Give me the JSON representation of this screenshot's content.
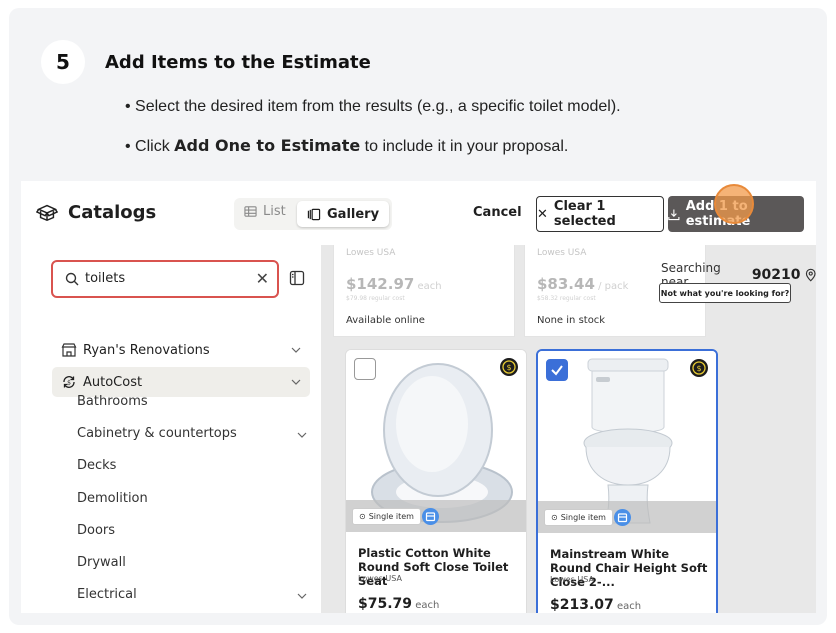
{
  "step": {
    "number": "5",
    "title": "Add Items to the Estimate",
    "bullets": [
      {
        "prefix": "• Select the desired item from the results (e.g., a specific toilet model).",
        "bold": "",
        "suffix": ""
      },
      {
        "prefix": "• Click ",
        "bold": "Add One to Estimate",
        "suffix": " to include it in your proposal."
      }
    ]
  },
  "app": {
    "title": "Catalogs",
    "view_list": "List",
    "view_gallery": "Gallery",
    "cancel": "Cancel",
    "clear_selected": "Clear 1 selected",
    "add_to_estimate": "Add 1 to estimate"
  },
  "search": {
    "value": "toilets"
  },
  "sidebar": {
    "items": [
      {
        "label": "Ryan's Renovations"
      },
      {
        "label": "AutoCost"
      }
    ],
    "subitems": [
      "Bathrooms",
      "Cabinetry & countertops",
      "Decks",
      "Demolition",
      "Doors",
      "Drywall",
      "Electrical"
    ]
  },
  "location": {
    "prefix": "Searching near",
    "zip": "90210",
    "not_what": "Not what you're looking for?"
  },
  "top_cards": [
    {
      "vendor": "Lowes USA",
      "price": "$142.97",
      "unit": " each",
      "regular": "$79.98 regular cost",
      "availability": "Available online"
    },
    {
      "vendor": "Lowes USA",
      "price": "$83.44",
      "unit": " / pack",
      "regular": "$58.32 regular cost",
      "availability": "None in stock"
    }
  ],
  "products": [
    {
      "name": "Plastic Cotton White Round Soft Close Toilet Seat",
      "vendor": "Lowes USA",
      "price": "$75.79",
      "unit": " each",
      "badge": "Single item",
      "selected": false
    },
    {
      "name": "Mainstream White Round Chair Height Soft Close 2-...",
      "vendor": "Lowes USA",
      "price": "$213.07",
      "unit": " each",
      "badge": "Single item",
      "selected": true
    }
  ],
  "colors": {
    "accent": "#3b6fd8",
    "highlight": "#f2994a",
    "search_border": "#d9534f",
    "primary_button": "#5b5858"
  }
}
